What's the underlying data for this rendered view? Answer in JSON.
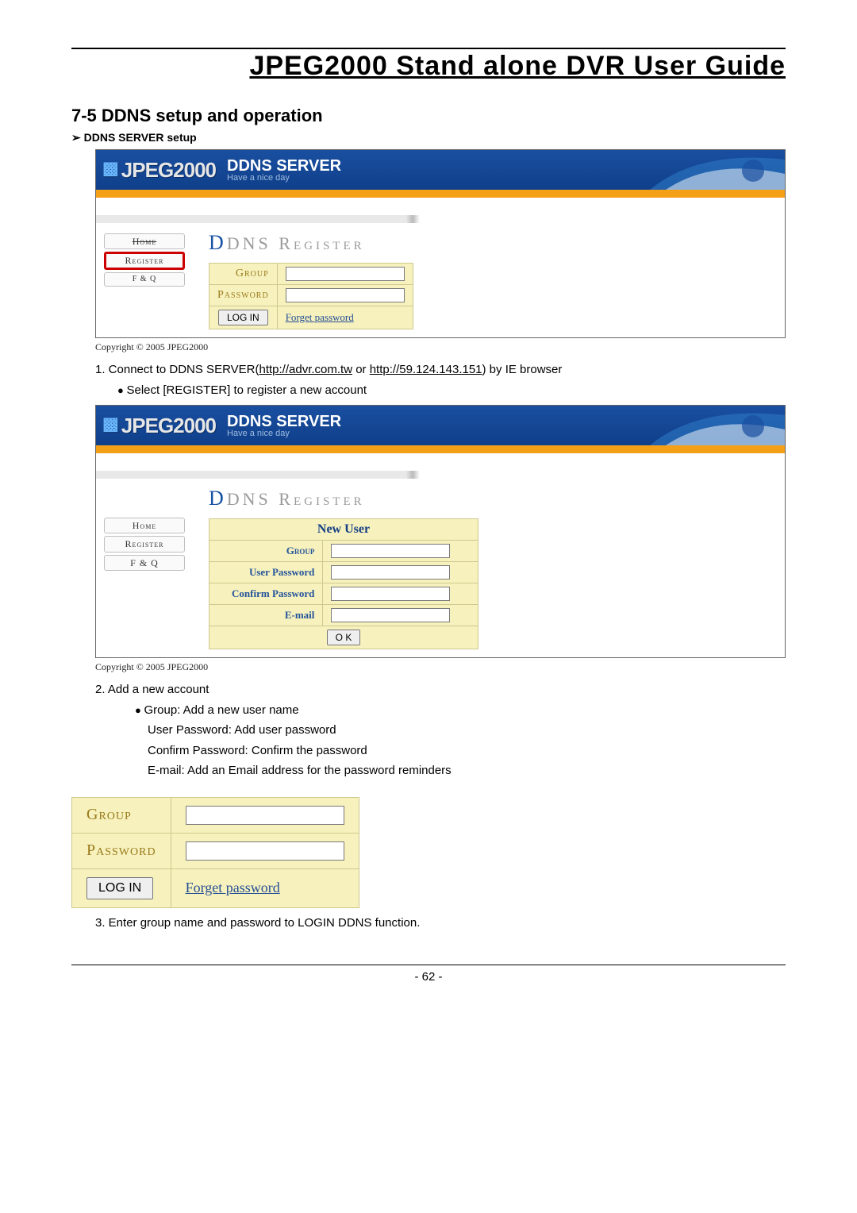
{
  "doc_title": "JPEG2000  Stand  alone  DVR  User  Guide",
  "section_heading": "7-5 DDNS setup and operation",
  "sub_heading": "DDNS SERVER setup",
  "banner": {
    "logo_text": "JPEG2000",
    "server_big": "DDNS SERVER",
    "server_tag": "Have a nice day",
    "nav_home": "Home",
    "nav_register": "Register",
    "nav_faq": "F & Q",
    "reg_title_D": "D",
    "reg_title_rest": "DNS Register"
  },
  "form1": {
    "group_lbl": "Group",
    "password_lbl": "Password",
    "login_btn": "LOG IN",
    "forget_link": "Forget password"
  },
  "copyright": "Copyright © 2005 JPEG2000",
  "step1_pre": "1.   Connect to DDNS SERVER(",
  "step1_url1": "http://advr.com.tw",
  "step1_mid": " or ",
  "step1_url2": "http://59.124.143.151",
  "step1_post": ") by IE browser",
  "step1_b": "Select [REGISTER] to register a new account",
  "form2": {
    "new_user": "New User",
    "group_lbl": "Group",
    "user_pw_lbl": "User Password",
    "confirm_pw_lbl": "Confirm Password",
    "email_lbl": "E-mail",
    "ok_btn": "O K"
  },
  "step2_head": "2. Add a new account",
  "step2_lines": {
    "a": "Group: Add a new user name",
    "b": "User Password: Add user password",
    "c": "Confirm Password: Confirm the password",
    "d": "E-mail: Add an Email address for the password reminders"
  },
  "big_login": {
    "group_lbl": "Group",
    "password_lbl": "Password",
    "login_btn": "LOG IN",
    "forget_link": "Forget password"
  },
  "step3": "3. Enter group name and password to LOGIN DDNS function.",
  "page_number": "- 62 -"
}
